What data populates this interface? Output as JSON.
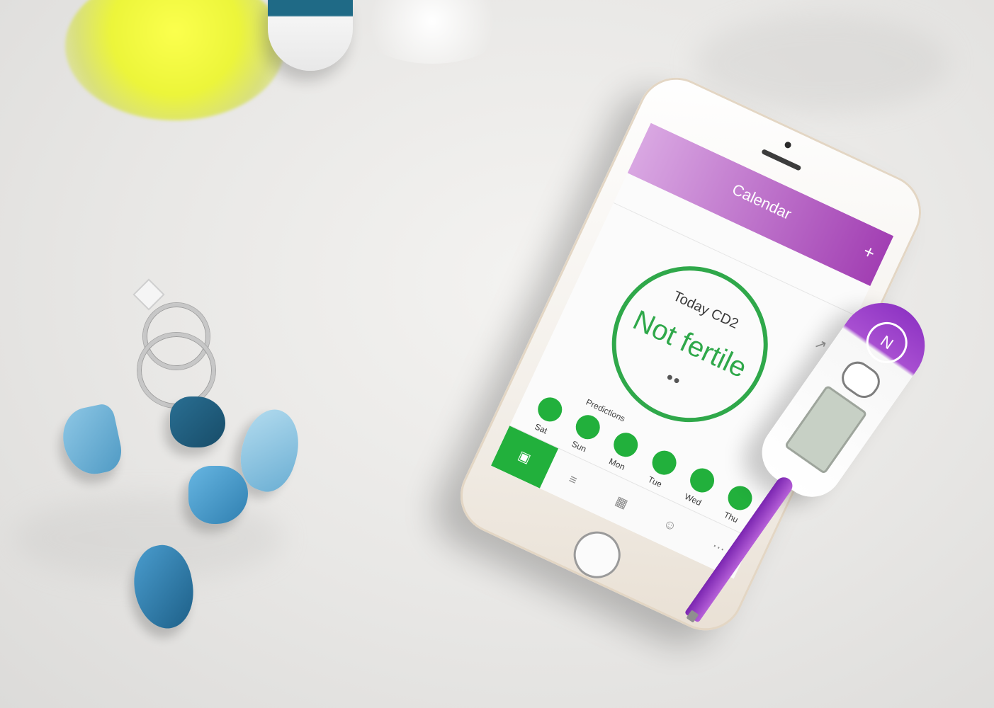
{
  "app": {
    "title": "Calendar",
    "plus_label": "+",
    "circle": {
      "today_label": "Today CD2",
      "status": "Not fertile",
      "drops_icon": "drops-icon"
    },
    "predictions_label": "Predictions",
    "days": [
      "Sat",
      "Sun",
      "Mon",
      "Tue",
      "Wed",
      "Thu"
    ],
    "tabs": [
      "calendar-icon",
      "chart-icon",
      "grid-icon",
      "person-icon",
      "more-icon"
    ]
  },
  "colors": {
    "brand_purple": "#a23fb3",
    "fertile_green": "#2fa84a",
    "dot_green": "#22b03c"
  }
}
